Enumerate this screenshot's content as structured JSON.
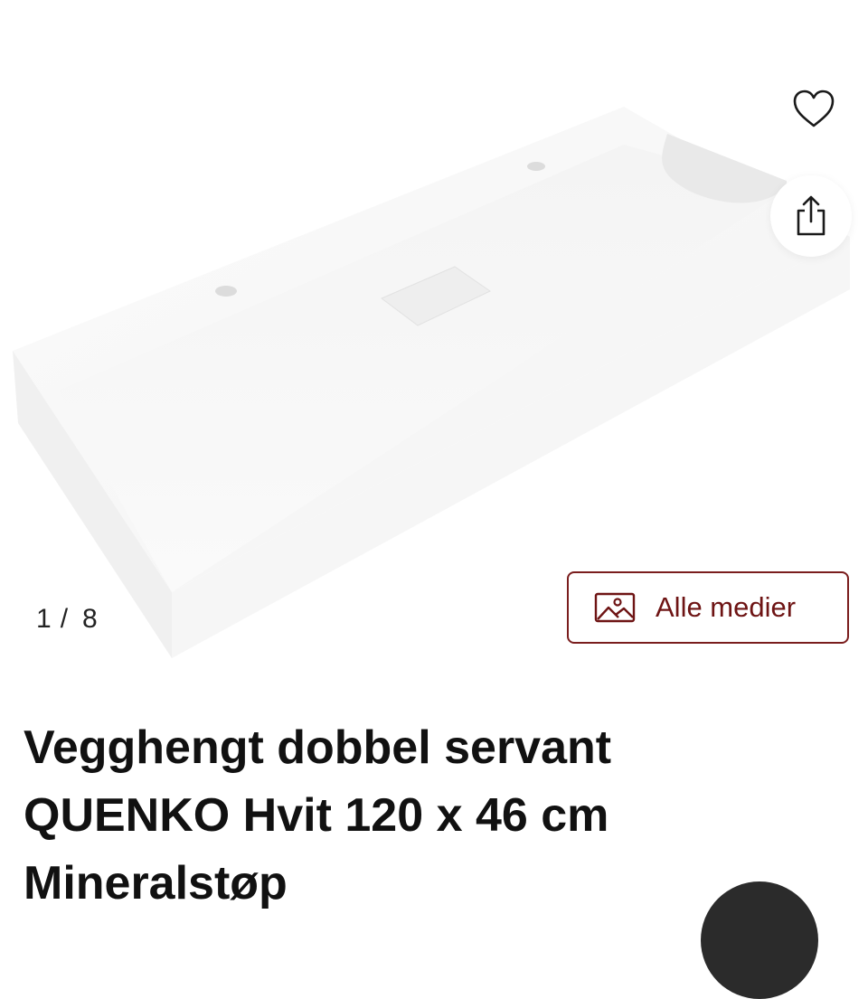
{
  "gallery": {
    "current": "1",
    "separator": "/",
    "total": "8",
    "all_media_label": "Alle medier"
  },
  "actions": {
    "favorite_icon": "heart-icon",
    "share_icon": "share-icon"
  },
  "product": {
    "title_lines": [
      "Vegghengt dobbel servant",
      "QUENKO Hvit 120 x 46 cm",
      "Mineralstøp"
    ]
  },
  "colors": {
    "accent": "#6e1414",
    "border": "#7a1d1d"
  }
}
